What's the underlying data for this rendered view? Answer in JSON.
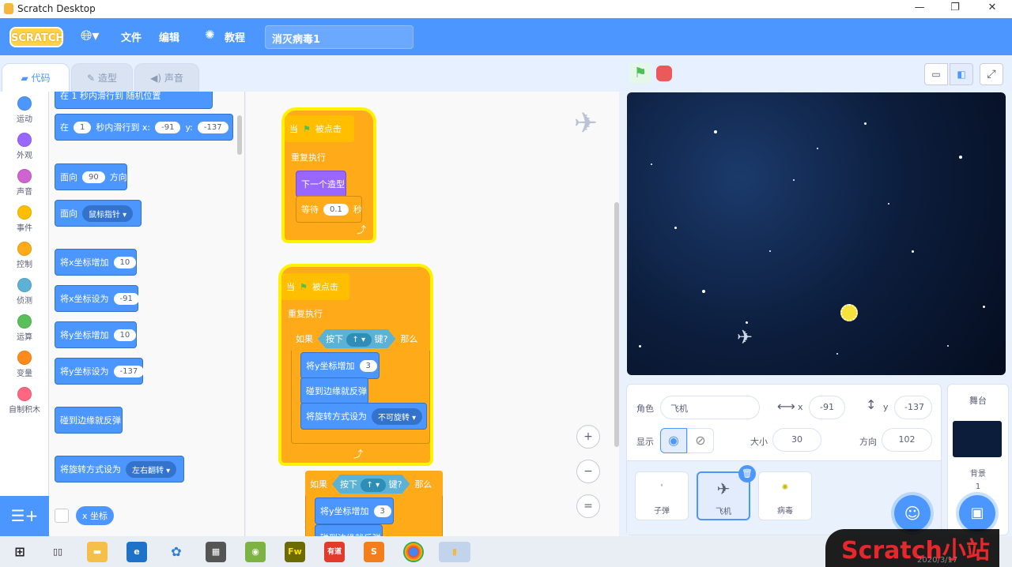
{
  "window": {
    "title": "Scratch Desktop"
  },
  "menu": {
    "logo": "SCRATCH",
    "file": "文件",
    "edit": "编辑",
    "tutorials": "教程",
    "project_title": "消灭病毒1"
  },
  "tabs": {
    "code": "代码",
    "costumes": "造型",
    "sounds": "声音"
  },
  "categories": [
    {
      "label": "运动",
      "color": "#4c97ff"
    },
    {
      "label": "外观",
      "color": "#9966ff"
    },
    {
      "label": "声音",
      "color": "#cf63cf"
    },
    {
      "label": "事件",
      "color": "#ffbf00"
    },
    {
      "label": "控制",
      "color": "#ffab19"
    },
    {
      "label": "侦测",
      "color": "#5cb1d6"
    },
    {
      "label": "运算",
      "color": "#59c059"
    },
    {
      "label": "变量",
      "color": "#ff8c1a"
    },
    {
      "label": "自制积木",
      "color": "#ff6680"
    }
  ],
  "palette": {
    "glide_partial": "在 1 秒内滑行到 随机位置",
    "glide_in": "在",
    "glide_secs": "1",
    "glide_mid": "秒内滑行到 x:",
    "glide_x": "-91",
    "glide_y_lbl": "y:",
    "glide_y": "-137",
    "point_dir": "面向",
    "point_dir_val": "90",
    "point_dir_suffix": "方向",
    "point_towards": "面向",
    "point_towards_val": "鼠标指针",
    "change_x": "将x坐标增加",
    "change_x_val": "10",
    "set_x": "将x坐标设为",
    "set_x_val": "-91",
    "change_y": "将y坐标增加",
    "change_y_val": "10",
    "set_y": "将y坐标设为",
    "set_y_val": "-137",
    "bounce": "碰到边缘就反弹",
    "rot_style": "将旋转方式设为",
    "rot_style_val": "左右翻转",
    "x_pos": "x 坐标"
  },
  "script1": {
    "hat_when": "当",
    "hat_clicked": "被点击",
    "forever": "重复执行",
    "next_costume": "下一个造型",
    "wait": "等待",
    "wait_val": "0.1",
    "wait_unit": "秒"
  },
  "script2": {
    "hat_when": "当",
    "hat_clicked": "被点击",
    "forever": "重复执行",
    "if": "如果",
    "key_pressed": "按下",
    "key": "↑",
    "key_q": "键?",
    "then": "那么",
    "change_y": "将y坐标增加",
    "change_y_val": "3",
    "bounce": "碰到边缘就反弹",
    "rot_style": "将旋转方式设为",
    "rot_style_val": "不可旋转"
  },
  "script3": {
    "if": "如果",
    "key_pressed": "按下",
    "key": "↑",
    "key_q": "键?",
    "then": "那么",
    "change_y": "将y坐标增加",
    "change_y_val": "3",
    "bounce": "碰到边缘就反弹"
  },
  "sprite_info": {
    "sprite_label": "角色",
    "sprite_name": "飞机",
    "x_label": "x",
    "x_val": "-91",
    "y_label": "y",
    "y_val": "-137",
    "show_label": "显示",
    "size_label": "大小",
    "size_val": "30",
    "dir_label": "方向",
    "dir_val": "102"
  },
  "sprites": [
    "子弹",
    "飞机",
    "病毒"
  ],
  "stage_pane": {
    "title": "舞台",
    "backdrops_label": "背景",
    "backdrops_count": "1"
  },
  "watermark": "Scratch小站",
  "taskbar_date": "2020/3/17"
}
